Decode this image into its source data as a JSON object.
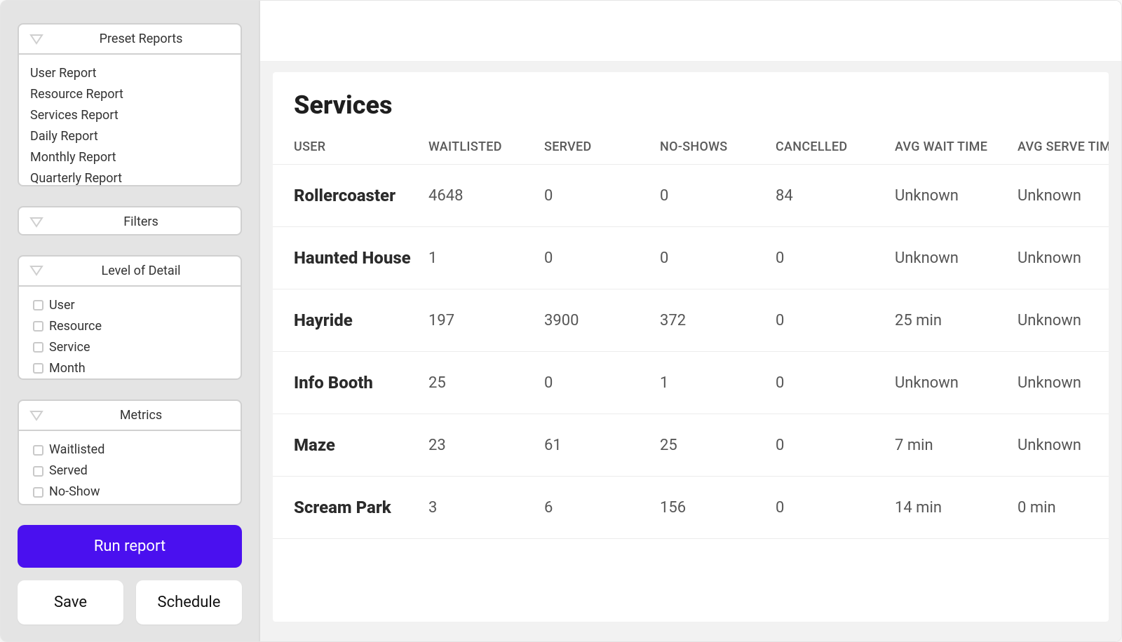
{
  "sidebar": {
    "preset_reports": {
      "title": "Preset Reports",
      "items": [
        "User Report",
        "Resource Report",
        "Services Report",
        "Daily Report",
        "Monthly Report",
        "Quarterly Report"
      ]
    },
    "filters": {
      "title": "Filters"
    },
    "level_of_detail": {
      "title": "Level of Detail",
      "options": [
        "User",
        "Resource",
        "Service",
        "Month"
      ]
    },
    "metrics": {
      "title": "Metrics",
      "options": [
        "Waitlisted",
        "Served",
        "No-Show"
      ]
    },
    "actions": {
      "run": "Run report",
      "save": "Save",
      "schedule": "Schedule"
    }
  },
  "main": {
    "title": "Services",
    "columns": [
      "USER",
      "WAITLISTED",
      "SERVED",
      "NO-SHOWS",
      "CANCELLED",
      "AVG WAIT TIME",
      "AVG SERVE TIME"
    ],
    "rows": [
      {
        "name": "Rollercoaster",
        "waitlisted": "4648",
        "served": "0",
        "no_shows": "0",
        "cancelled": "84",
        "avg_wait": "Unknown",
        "avg_serve": "Unknown"
      },
      {
        "name": "Haunted House",
        "waitlisted": "1",
        "served": "0",
        "no_shows": "0",
        "cancelled": "0",
        "avg_wait": "Unknown",
        "avg_serve": "Unknown"
      },
      {
        "name": "Hayride",
        "waitlisted": "197",
        "served": "3900",
        "no_shows": "372",
        "cancelled": "0",
        "avg_wait": "25 min",
        "avg_serve": "Unknown"
      },
      {
        "name": "Info Booth",
        "waitlisted": "25",
        "served": "0",
        "no_shows": "1",
        "cancelled": "0",
        "avg_wait": "Unknown",
        "avg_serve": "Unknown"
      },
      {
        "name": "Maze",
        "waitlisted": "23",
        "served": "61",
        "no_shows": "25",
        "cancelled": "0",
        "avg_wait": "7 min",
        "avg_serve": "Unknown"
      },
      {
        "name": "Scream Park",
        "waitlisted": "3",
        "served": "6",
        "no_shows": "156",
        "cancelled": "0",
        "avg_wait": "14 min",
        "avg_serve": "0 min"
      }
    ]
  },
  "colors": {
    "primary": "#4a10ef"
  }
}
